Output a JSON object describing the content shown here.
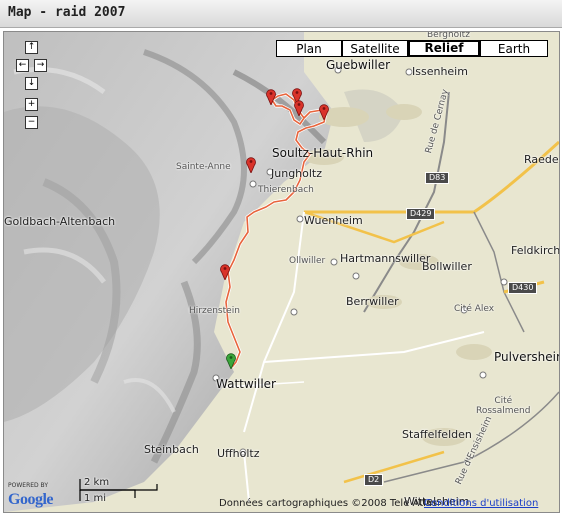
{
  "window": {
    "title": "Map - raid 2007"
  },
  "map_types": [
    {
      "label": "Plan",
      "active": false
    },
    {
      "label": "Satellite",
      "active": false
    },
    {
      "label": "Relief",
      "active": true
    },
    {
      "label": "Earth",
      "active": false
    }
  ],
  "nav": {
    "up": "↑",
    "left": "←",
    "right": "→",
    "down": "↓",
    "zoom_in": "+",
    "zoom_out": "−"
  },
  "places": {
    "guebwiller": "Guebwiller",
    "issenheim": "Issenheim",
    "soultz": "Soultz-Haut-Rhin",
    "sainte_anne": "Sainte-Anne",
    "jungholtz": "Jungholtz",
    "thierenbach": "Thierenbach",
    "wuenheim": "Wuenheim",
    "goldbach": "Goldbach-Altenbach",
    "ollwiller": "Ollwiller",
    "hartmannswiller": "Hartmannswiller",
    "bollwiller": "Bollwiller",
    "feldkirch": "Feldkirch",
    "berrwiller": "Berrwiller",
    "cite_alex": "Cité Alex",
    "hirzenstein": "Hirzenstein",
    "pulversheim": "Pulversheim",
    "wattwiller": "Wattwiller",
    "cite_rossalmend": "Cité\nRossalmend",
    "staffelfelden": "Staffelfelden",
    "steinbach": "Steinbach",
    "uffholtz": "Uffholtz",
    "raedersheim": "Raede",
    "bergholtz": "Bergholtz",
    "wittelsheim": "Wittelsheim",
    "rue_cernay": "Rue de Cernay",
    "rue_ensisheim": "Rue d'Ensisheim"
  },
  "roads": {
    "d83": "D83",
    "d429": "D429",
    "d430": "D430",
    "d2": "D2"
  },
  "scale": {
    "km": "2 km",
    "mi": "1 mi"
  },
  "footer": {
    "powered_by": "POWERED BY",
    "logo": "Google",
    "copyright": "Données cartographiques ©2008 Tele Atlas",
    "terms": "Conditions d'utilisation"
  },
  "colors": {
    "route": "#e8643c",
    "marker_red": "#d9332a",
    "marker_green": "#3aa63a",
    "relief_bg": "#e7e5d0"
  },
  "icons": [
    "pan-up-icon",
    "pan-left-icon",
    "pan-right-icon",
    "pan-down-icon",
    "zoom-in-icon",
    "zoom-out-icon",
    "map-marker-icon"
  ]
}
